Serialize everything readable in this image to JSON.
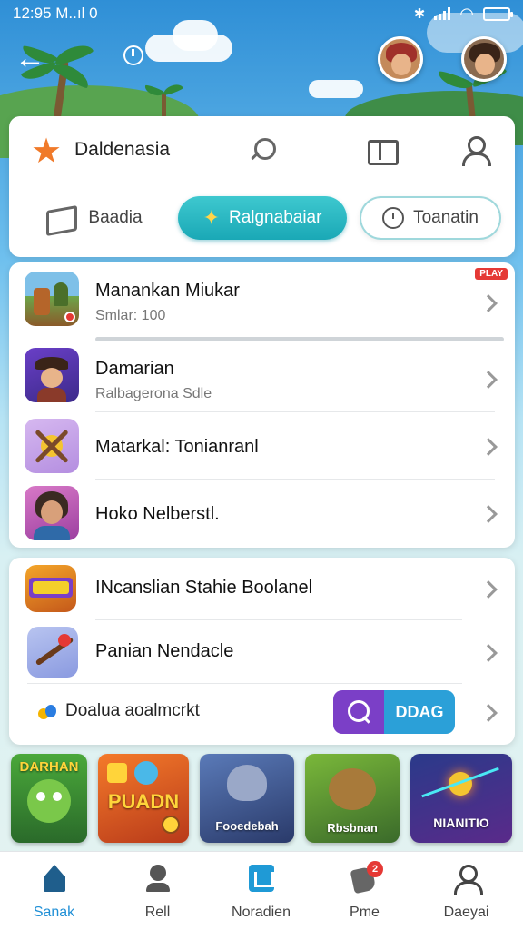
{
  "status_bar": {
    "time": "12:95 M..ıl  0"
  },
  "header": {
    "brand": "Daldenasia",
    "tabs": [
      {
        "label": "Baadia"
      },
      {
        "label": "Ralgnabaiar",
        "active": true
      },
      {
        "label": "Toanatin"
      }
    ]
  },
  "list": {
    "items": [
      {
        "title": "Manankan Miukar",
        "subtitle": "Smlar: 100",
        "progress": 0.0
      },
      {
        "title": "Damarian",
        "subtitle": "Ralbagerona Sdle"
      },
      {
        "title": "Matarkal: Tonianranl"
      },
      {
        "title": "Hoko Nelberstl."
      }
    ],
    "badge": "PLAY"
  },
  "list2": {
    "items": [
      {
        "title": "INcanslian Stahie Boolanel"
      },
      {
        "title": "Panian Nendacle"
      }
    ],
    "footer_label": "Doalua aoalmcrkt",
    "drag_label": "DDAG"
  },
  "tiles": [
    {
      "label": "DARHAN"
    },
    {
      "label": "PUADN"
    },
    {
      "label": "Fooedebah"
    },
    {
      "label": "Rbsbnan"
    },
    {
      "label": "NIANITIO"
    }
  ],
  "bottom_nav": [
    {
      "label": "Sanak",
      "active": true
    },
    {
      "label": "Rell"
    },
    {
      "label": "Noradien"
    },
    {
      "label": "Pme",
      "badge": "2"
    },
    {
      "label": "Daeyai"
    }
  ],
  "colors": {
    "accent": "#1aa8b6",
    "primary": "#1f8fd6",
    "purple": "#7b3fc7",
    "badge": "#e53935"
  }
}
